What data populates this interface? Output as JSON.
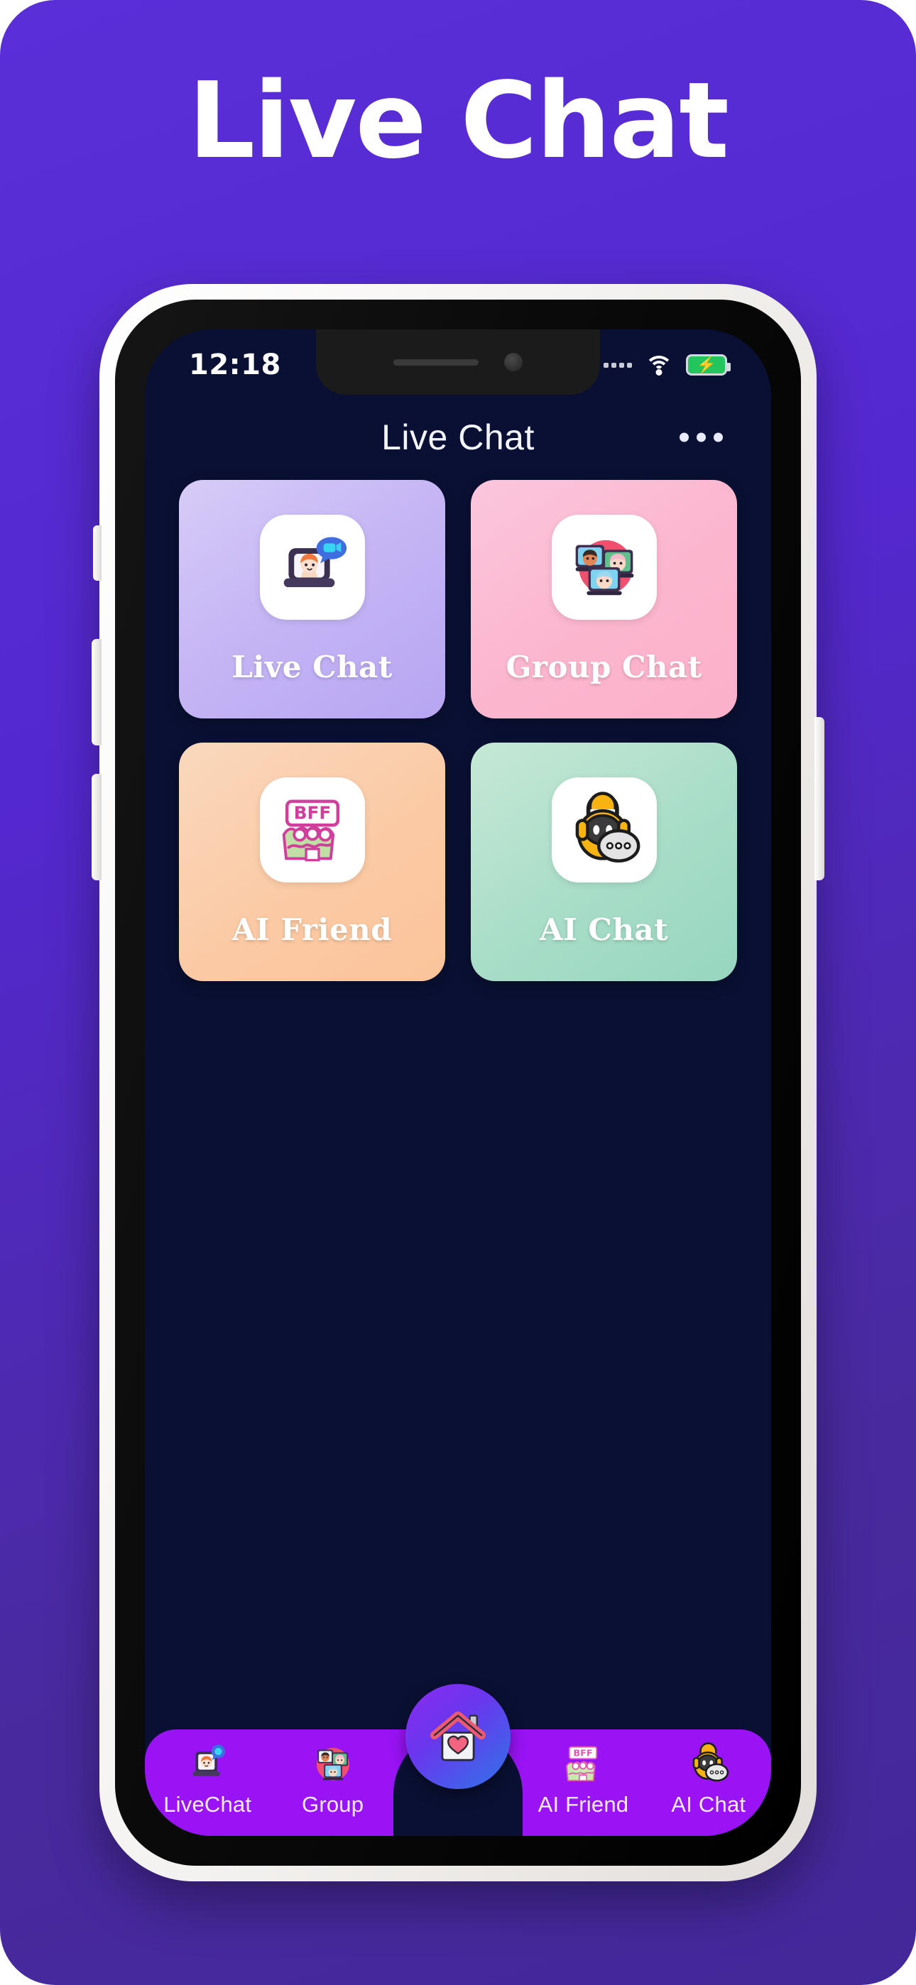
{
  "poster": {
    "title": "Live Chat",
    "background_color": "#5428cf"
  },
  "phone": {
    "status_bar": {
      "time": "12:18",
      "signal_icon": "signal-dots-icon",
      "wifi_icon": "wifi-icon",
      "battery_icon": "battery-charging-icon",
      "battery_color": "#22c55e"
    },
    "app_header": {
      "title": "Live Chat",
      "more_icon": "more-horizontal-icon"
    },
    "screen_background": "#0a1033"
  },
  "feature_grid": {
    "cards": [
      {
        "label": "Live Chat",
        "icon": "laptop-video-call-icon",
        "color": "#c6b6f5"
      },
      {
        "label": "Group Chat",
        "icon": "group-video-call-icon",
        "color": "#fbb7cf"
      },
      {
        "label": "AI Friend",
        "icon": "bff-friends-icon",
        "color": "#fbcaa5"
      },
      {
        "label": "AI Chat",
        "icon": "robot-chat-bubble-icon",
        "color": "#a8ddc8"
      }
    ]
  },
  "bottom_nav": {
    "background_color": "#9913f5",
    "items": [
      {
        "label": "LiveChat",
        "icon": "livechat-icon"
      },
      {
        "label": "Group",
        "icon": "group-icon"
      },
      {
        "label": "AI Friend",
        "icon": "ai-friend-icon"
      },
      {
        "label": "AI Chat",
        "icon": "ai-chat-icon"
      }
    ],
    "home_button": {
      "icon": "house-heart-icon",
      "gradient_from": "#8c2bf0",
      "gradient_to": "#2f74e8"
    }
  }
}
